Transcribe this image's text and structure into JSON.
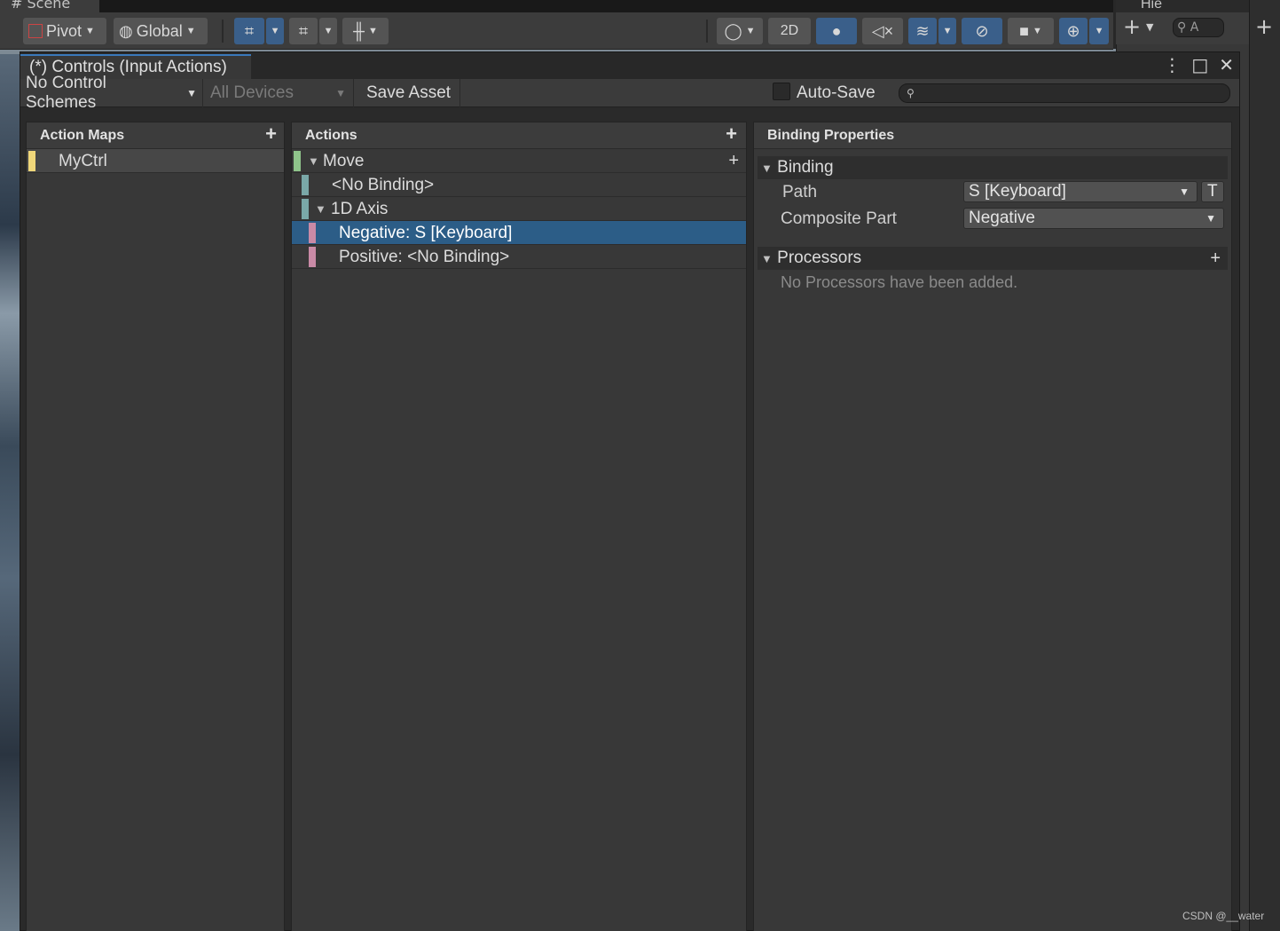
{
  "scene": {
    "tab_label": "# Scene",
    "pivot_label": "Pivot",
    "global_label": "Global",
    "mode_2d": "2D"
  },
  "hierarchy": {
    "tab_label": "Hie",
    "search_placeholder": "A"
  },
  "window": {
    "title": "(*) Controls (Input Actions)"
  },
  "toolbar": {
    "control_schemes": "No Control Schemes",
    "devices": "All Devices",
    "save_asset": "Save Asset",
    "auto_save": "Auto-Save",
    "search_placeholder": ""
  },
  "action_maps": {
    "header": "Action Maps",
    "items": [
      {
        "label": "MyCtrl",
        "color": "#f0d77a"
      }
    ]
  },
  "actions": {
    "header": "Actions",
    "rows": [
      {
        "label": "Move",
        "color": "#8fc48b"
      },
      {
        "label": "<No Binding>",
        "color": "#7aa8a8"
      },
      {
        "label": "1D Axis",
        "color": "#7aa8a8"
      },
      {
        "label": "Negative: S [Keyboard]",
        "color": "#c98aa6"
      },
      {
        "label": "Positive: <No Binding>",
        "color": "#c98aa6"
      }
    ]
  },
  "binding_properties": {
    "header": "Binding Properties",
    "binding_section": "Binding",
    "path_label": "Path",
    "path_value": "S [Keyboard]",
    "t_button": "T",
    "composite_label": "Composite Part",
    "composite_value": "Negative",
    "processors_section": "Processors",
    "no_processors": "No Processors have been added."
  },
  "watermark": "CSDN @__water",
  "colors": {
    "accent": "#3a79bb",
    "selection": "#2c5d87"
  }
}
